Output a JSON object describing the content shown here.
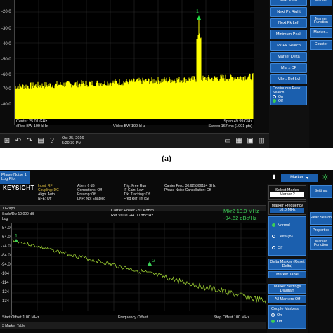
{
  "panel_a": {
    "y_axis_labels": [
      "-20.0",
      "-30.0",
      "-40.0",
      "-50.0",
      "-60.0",
      "-70.0",
      "-80.0"
    ],
    "center": "Center 25.01 GHz",
    "res_bw": "#Res BW 100 kHz",
    "video_bw": "Video BW 100 kHz",
    "span": "Span 49.99 GHz",
    "sweep": "Sweep 167 ms (1001 pts)",
    "marker_number": "1",
    "date": "Oct 25, 2016",
    "time": "5:20:39 PM",
    "softkeys": [
      "Next Peak",
      "Next Pk Right",
      "Next Pk Left",
      "Minimum Peak",
      "Pk-Pk Search",
      "Marker Delta",
      "Mkr→CF",
      "Mkr→Ref Lvl"
    ],
    "continuous_peak": {
      "title": "Continuous Peak Search",
      "on": "On",
      "off": "Off",
      "selected": "Off"
    },
    "side_tabs": [
      "Marker",
      "Marker Function",
      "Marker→",
      "Counter"
    ],
    "caption": "(a)",
    "trace_color": "#ffff00"
  },
  "panel_b": {
    "tab_title": "Phase Noise 1",
    "tab_sub": "Log Plot",
    "brand": "KEYSIGHT",
    "header_col1": [
      "Input: RF",
      "Coupling: DC",
      "Align: Auto",
      "NFE: Off"
    ],
    "header_col2": [
      "Atten: 6 dB",
      "Corrections: Off",
      "Preamp: Off",
      "LNP: Not Enabled"
    ],
    "header_col3": [
      "Trig: Free Run",
      "IF Gain: Low",
      "Trk: Tracking: Off",
      "Freq Ref: Int (S)"
    ],
    "header_col4": [
      "Carrier Freq: 30.625306114 GHz",
      "Phase Noise Cancellation: Off"
    ],
    "graph_label": "1 Graph",
    "scale": "Scale/Div 10.000 dB",
    "log": "Log",
    "carrier_power": "Carrier Power -20.4 dBm",
    "ref_value": "Ref Value -44.00 dBc/Hz",
    "mkr_readout": "Mkr2  10.0 MHz",
    "mkr_value": "-94.62 dBc/Hz",
    "y_axis_labels": [
      "-54.0",
      "-64.0",
      "-74.0",
      "-84.0",
      "-94.0",
      "-104",
      "-114",
      "-124",
      "-134"
    ],
    "start": "Start Offset 1.00 MHz",
    "freq_offset": "Frequency Offset",
    "stop": "Stop Offset 100 MHz",
    "marker_table": "3 Marker Table",
    "top_right": "Marker",
    "settings_tab": "Settings",
    "select_marker_title": "Select Marker",
    "select_marker_value": "Marker 2",
    "marker_freq_title": "Marker Frequency",
    "marker_freq_value": "10.0 MHz",
    "mode_options": [
      "Normal",
      "Delta (Δ)",
      "Off"
    ],
    "mode_selected": "Normal",
    "buttons": [
      "Delta Marker (Reset Delta)",
      "Marker Table",
      "Marker Settings Diagram",
      "All Markers Off"
    ],
    "couple": {
      "title": "Couple Markers",
      "on": "On",
      "off": "Off"
    },
    "side_tabs": [
      "Settings",
      "Peak Search",
      "Properties",
      "Marker Function"
    ],
    "marker1_label": "1",
    "marker2_label": "2",
    "trace_color": "#9acd32"
  }
}
